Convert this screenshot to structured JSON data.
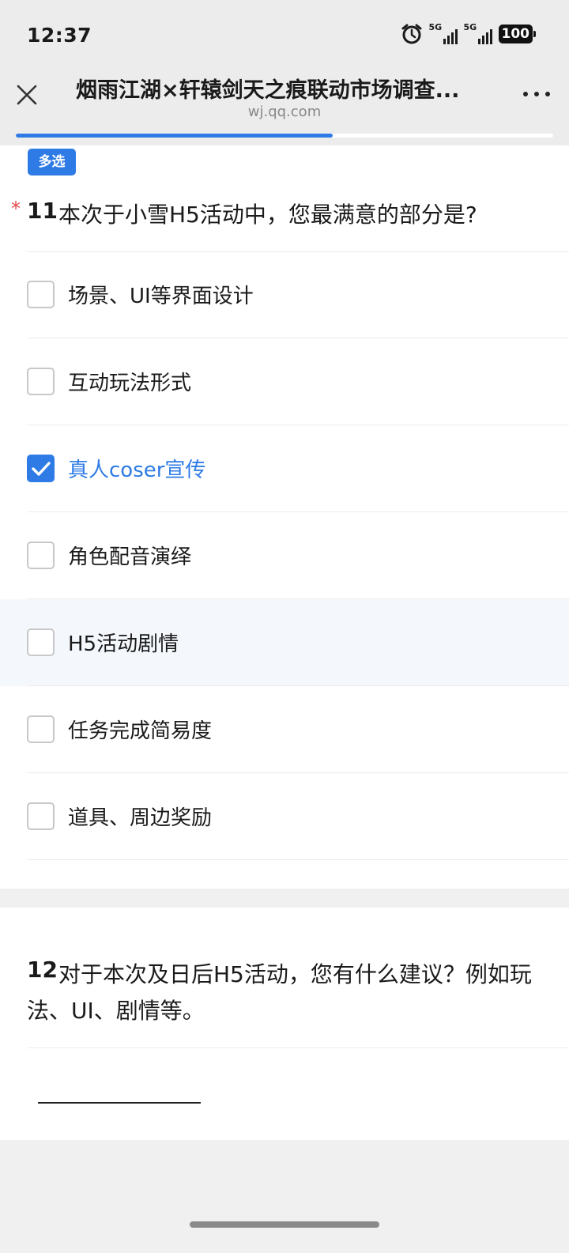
{
  "status_bar": {
    "time": "12:37",
    "network_1": "5G",
    "network_2": "5G",
    "battery": "100"
  },
  "header": {
    "title": "烟雨江湖×轩辕剑天之痕联动市场调查...",
    "url": "wj.qq.com",
    "close_icon": "close-icon",
    "more_icon": "more-icon"
  },
  "progress": {
    "percent": 59,
    "color": "#2e7be6"
  },
  "question_11": {
    "badge": "多选",
    "required_mark": "*",
    "number": "11",
    "text": "本次于小雪H5活动中，您最满意的部分是?",
    "options": [
      {
        "label": "场景、UI等界面设计",
        "checked": false
      },
      {
        "label": "互动玩法形式",
        "checked": false
      },
      {
        "label": "真人coser宣传",
        "checked": true
      },
      {
        "label": "角色配音演绎",
        "checked": false
      },
      {
        "label": "H5活动剧情",
        "checked": false
      },
      {
        "label": "任务完成简易度",
        "checked": false
      },
      {
        "label": "道具、周边奖励",
        "checked": false
      }
    ]
  },
  "question_12": {
    "number": "12",
    "text": "对于本次及日后H5活动，您有什么建议？例如玩法、UI、剧情等。",
    "answer": ""
  },
  "colors": {
    "accent": "#2e7be6",
    "required": "#e5484d"
  }
}
